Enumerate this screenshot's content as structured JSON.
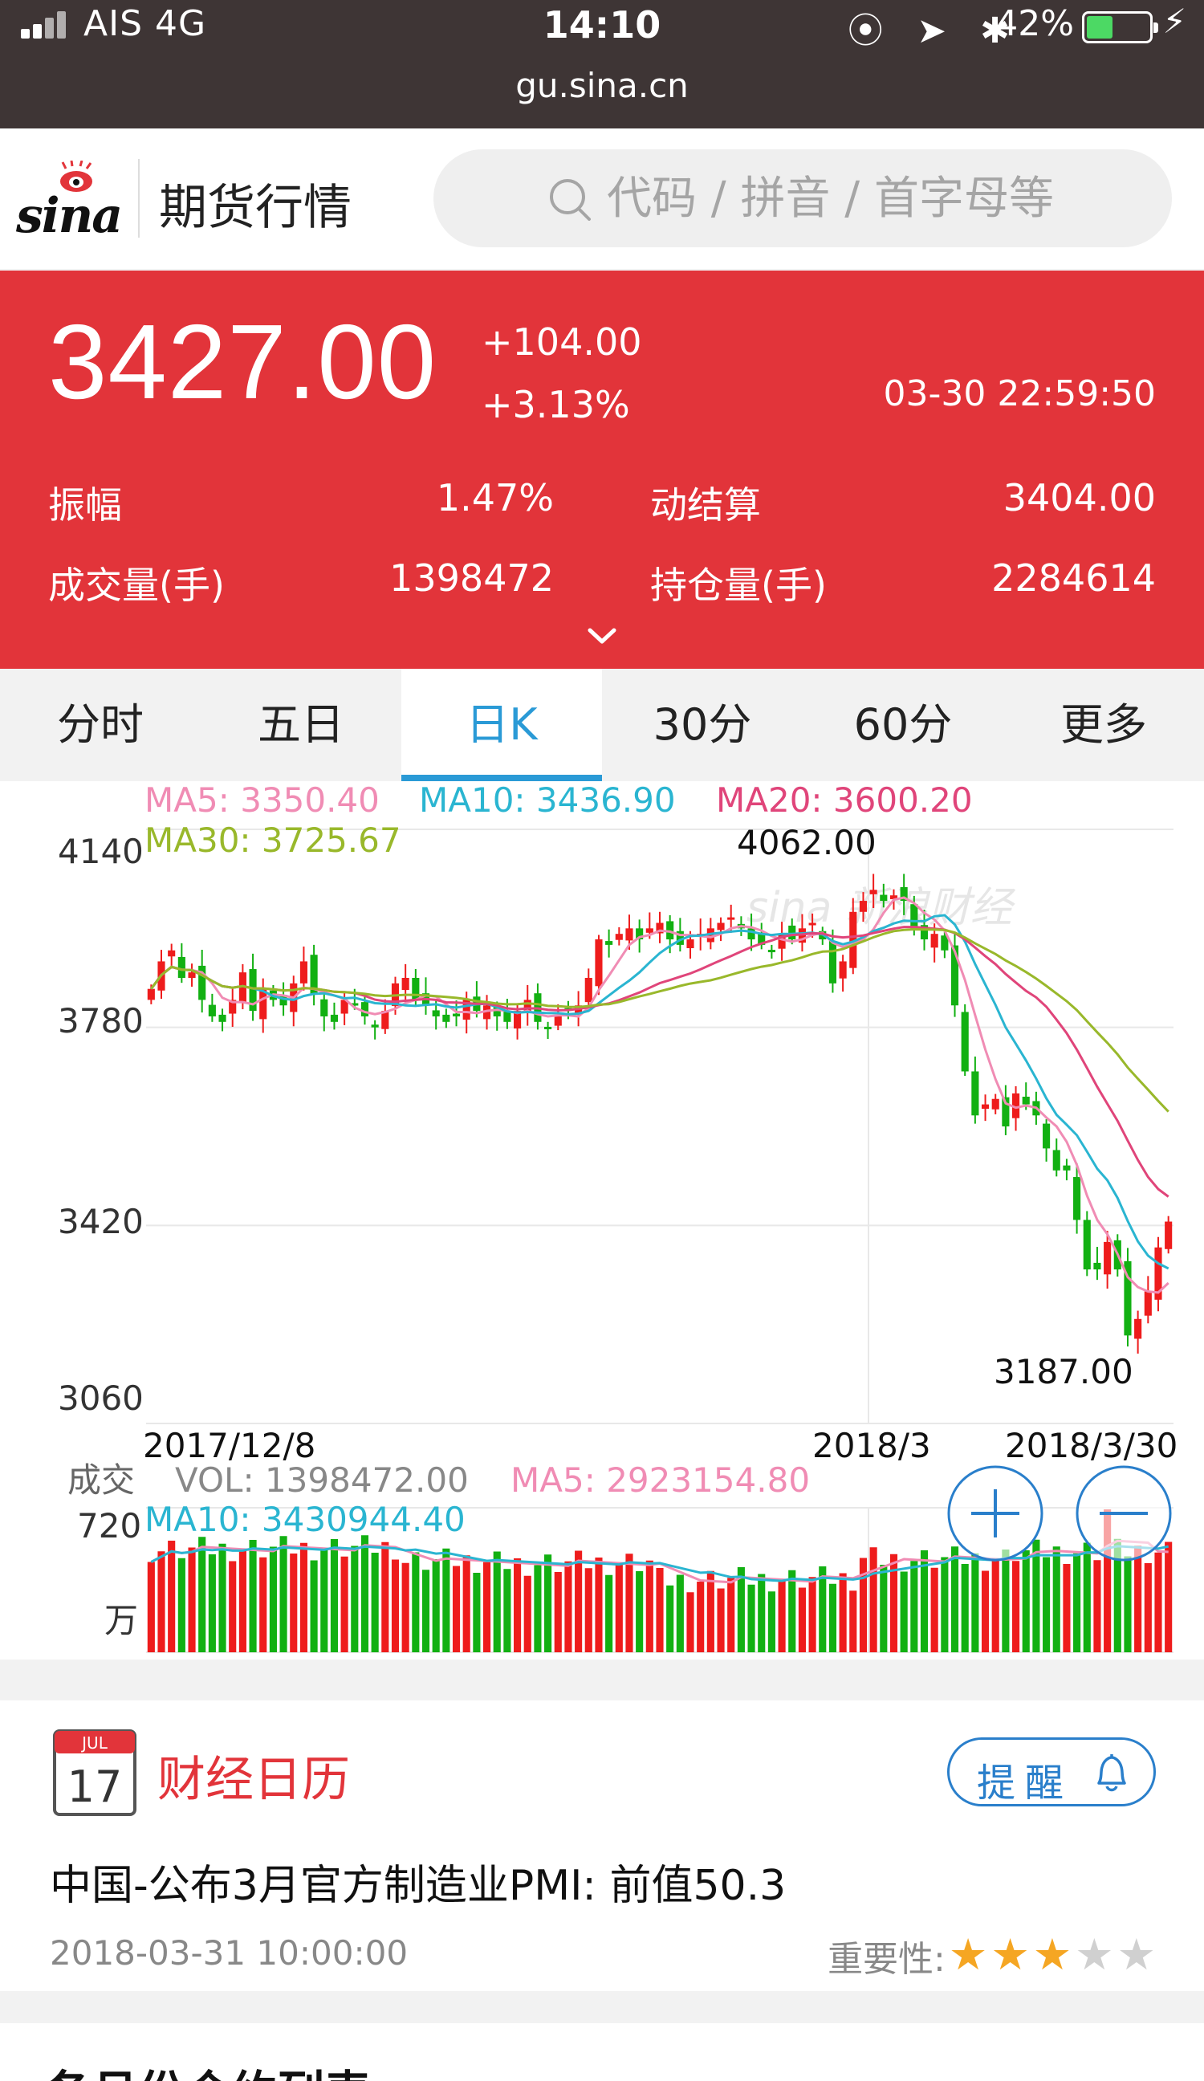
{
  "status_bar": {
    "carrier": "AIS   4G",
    "time": "14:10",
    "icons": "⦿ ➤ ✱",
    "battery_pct": "42%",
    "battery_level": 0.42,
    "url": "gu.sina.cn"
  },
  "header": {
    "logo_text": "sina",
    "title": "期货行情",
    "search_placeholder": "代码 / 拼音 / 首字母等"
  },
  "quote": {
    "price": "3427.00",
    "change_abs": "+104.00",
    "change_pct": "+3.13%",
    "timestamp": "03-30 22:59:50",
    "fields": [
      {
        "label": "振幅",
        "value": "1.47%"
      },
      {
        "label": "动结算",
        "value": "3404.00"
      },
      {
        "label": "成交量(手)",
        "value": "1398472"
      },
      {
        "label": "持仓量(手)",
        "value": "2284614"
      }
    ],
    "color_up": "#e2343a"
  },
  "tabs": [
    {
      "label": "分时",
      "active": false
    },
    {
      "label": "五日",
      "active": false
    },
    {
      "label": "日K",
      "active": true
    },
    {
      "label": "30分",
      "active": false
    },
    {
      "label": "60分",
      "active": false
    },
    {
      "label": "更多",
      "active": false
    }
  ],
  "chart_data": {
    "type": "candlestick",
    "legend": [
      {
        "text": "MA5: 3350.40",
        "color": "#f08cb4"
      },
      {
        "text": "MA10: 3436.90",
        "color": "#2ab5d1"
      },
      {
        "text": "MA20: 3600.20",
        "color": "#e0457a"
      },
      {
        "text": "MA30: 3725.67",
        "color": "#99b82b"
      }
    ],
    "y_ticks": [
      4140,
      3780,
      3420,
      3060
    ],
    "ylim": [
      3060,
      4140
    ],
    "x_labels": [
      "2017/12/8",
      "2018/3",
      "2018/3/30"
    ],
    "high_label": "4062.00",
    "low_label": "3187.00",
    "watermark": "sina 新浪财经",
    "closes": [
      3850,
      3900,
      3920,
      3870,
      3880,
      3830,
      3800,
      3790,
      3830,
      3880,
      3810,
      3850,
      3830,
      3820,
      3860,
      3900,
      3840,
      3800,
      3790,
      3830,
      3820,
      3800,
      3780,
      3810,
      3860,
      3870,
      3830,
      3820,
      3800,
      3790,
      3800,
      3830,
      3810,
      3820,
      3800,
      3790,
      3810,
      3830,
      3790,
      3780,
      3800,
      3810,
      3820,
      3870,
      3940,
      3930,
      3950,
      3960,
      3940,
      3960,
      3970,
      3940,
      3930,
      3940,
      3950,
      3960,
      3970,
      3980,
      3960,
      3940,
      3930,
      3920,
      3950,
      3940,
      3960,
      3970,
      3940,
      3860,
      3900,
      3990,
      4010,
      4030,
      4010,
      4020,
      4010,
      3960,
      3940,
      3950,
      3920,
      3820,
      3700,
      3620,
      3640,
      3650,
      3600,
      3660,
      3640,
      3620,
      3560,
      3520,
      3520,
      3430,
      3340,
      3340,
      3390,
      3340,
      3220,
      3250,
      3300,
      3380,
      3427
    ],
    "ma_series": [
      {
        "name": "MA5",
        "color": "#f08cb4",
        "period": 5
      },
      {
        "name": "MA10",
        "color": "#2ab5d1",
        "period": 10
      },
      {
        "name": "MA20",
        "color": "#e0457a",
        "period": 20
      },
      {
        "name": "MA30",
        "color": "#99b82b",
        "period": 30
      }
    ],
    "up_color": "#ee1c1c",
    "down_color": "#12b012",
    "volume": {
      "label": "成交",
      "vol_text": "VOL: 1398472.00",
      "ma5_text": "MA5: 2923154.80",
      "ma10_text": "MA10: 3430944.40",
      "y_top_label": "720",
      "unit": "万",
      "ylim": [
        0,
        720
      ]
    }
  },
  "calendar": {
    "icon_month": "JUL",
    "icon_day": "17",
    "title": "财经日历",
    "remind_label": "提醒",
    "event": "中国-公布3月官方制造业PMI: 前值50.3",
    "event_time": "2018-03-31 10:00:00",
    "importance_label": "重要性:",
    "importance_stars": 3,
    "importance_max": 5,
    "star_on_color": "#f5a623",
    "star_off_color": "#d0d0d0"
  },
  "next_section": {
    "title": "各月份合约列表"
  }
}
